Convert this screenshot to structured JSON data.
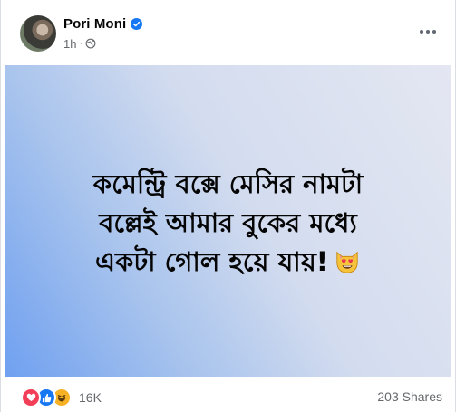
{
  "post": {
    "author": {
      "name": "Pori Moni",
      "verified": true
    },
    "time": "1h",
    "privacy_icon": "globe-icon",
    "more_icon": "more-options-icon",
    "text_lines": [
      "কমেন্ট্রি বক্সে মেসির নামটা",
      "বল্লেই আমার বুকের মধ্যে",
      "একটা গোল হয়ে যায়!"
    ],
    "emoji": "heart-eyes-cat-emoji",
    "background_colors": [
      "#6fa0f0",
      "#e4e7f2"
    ]
  },
  "footer": {
    "reactions": [
      "love-reaction-icon",
      "like-reaction-icon",
      "haha-reaction-icon"
    ],
    "reaction_count": "16K",
    "shares": "203 Shares"
  }
}
